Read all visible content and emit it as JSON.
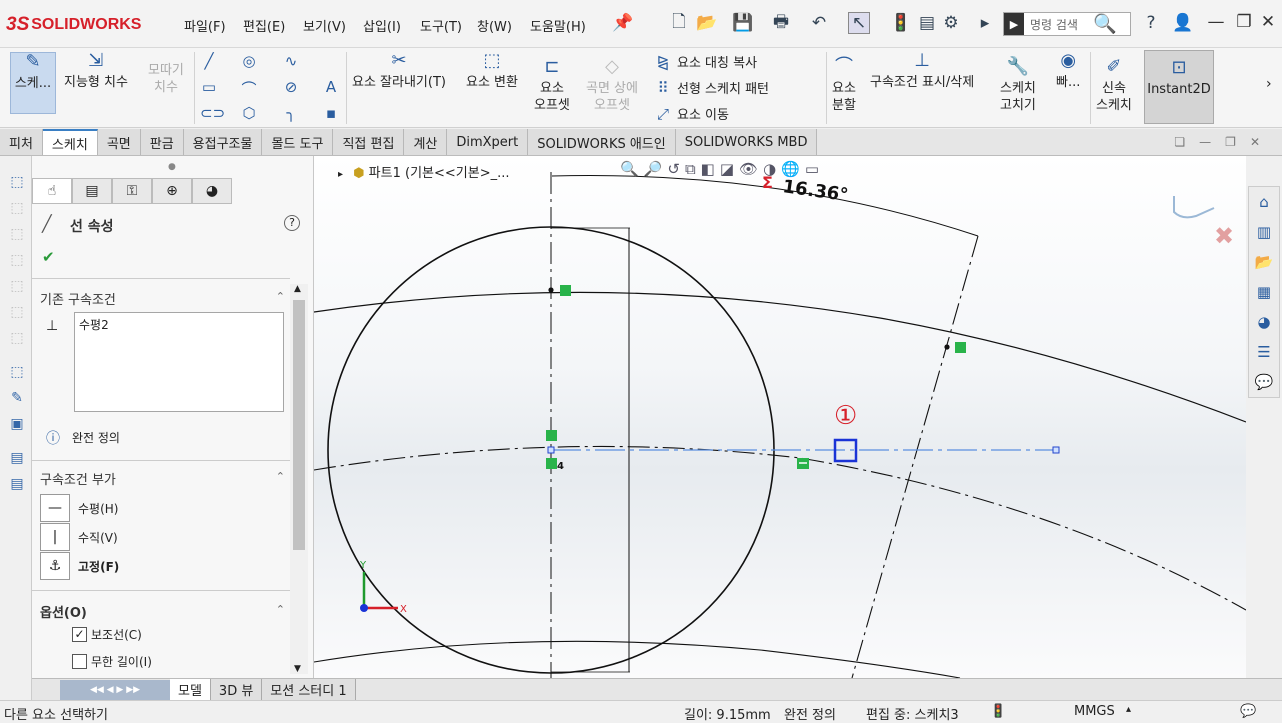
{
  "app": {
    "logo_ds": "3S",
    "logo_text": "SOLIDWORKS"
  },
  "menu": [
    "파일(F)",
    "편집(E)",
    "보기(V)",
    "삽입(I)",
    "도구(T)",
    "창(W)",
    "도움말(H)"
  ],
  "search": {
    "placeholder": "명령 검색"
  },
  "ribbon": {
    "sketch": "스케...",
    "smart_dim": "지능형 치수",
    "chamfer_dim_1": "모따기",
    "chamfer_dim_2": "치수",
    "trim": "요소 잘라내기(T)",
    "convert": "요소 변환",
    "offset_1": "요소",
    "offset_2": "오프셋",
    "face_offset_1": "곡면 상에",
    "face_offset_2": "오프셋",
    "mirror": "요소 대칭 복사",
    "linear_pattern": "선형 스케치 패턴",
    "move": "요소 이동",
    "split_1": "요소",
    "split_2": "분할",
    "show_rel": "구속조건 표시/삭제",
    "repair_1": "스케치",
    "repair_2": "고치기",
    "quick": "빠...",
    "rapid_1": "신속",
    "rapid_2": "스케치",
    "instant2d": "Instant2D"
  },
  "tabs": [
    "피처",
    "스케치",
    "곡면",
    "판금",
    "용접구조물",
    "몰드 도구",
    "직접 편집",
    "계산",
    "DimXpert",
    "SOLIDWORKS 애드인",
    "SOLIDWORKS MBD"
  ],
  "active_tab": "스케치",
  "pm": {
    "title": "선 속성",
    "existing_header": "기존 구속조건",
    "existing_items": [
      "수평2"
    ],
    "status": "완전 정의",
    "add_header": "구속조건 부가",
    "add_items": [
      "수평(H)",
      "수직(V)",
      "고정(F)"
    ],
    "options_header": "옵션(O)",
    "opt_construction": "보조선(C)",
    "opt_infinite": "무한 길이(I)"
  },
  "viewport": {
    "tree_label": "파트1  (기본<<기본>_...",
    "angle_dim": "16.36°",
    "callout": "①",
    "relation_tag": "4",
    "triad_x": "X",
    "triad_y": "Y"
  },
  "bottom_tabs": [
    "모델",
    "3D 뷰",
    "모션 스터디 1"
  ],
  "status": {
    "left": "다른 요소 선택하기",
    "length": "길이: 9.15mm",
    "defined": "완전 정의",
    "editing": "편집 중: 스케치3",
    "units": "MMGS"
  },
  "colors": {
    "brand_red": "#d6202a",
    "accent_blue": "#2a5d9f",
    "selection_blue": "#1a33d6",
    "relation_green": "#29b34a"
  }
}
